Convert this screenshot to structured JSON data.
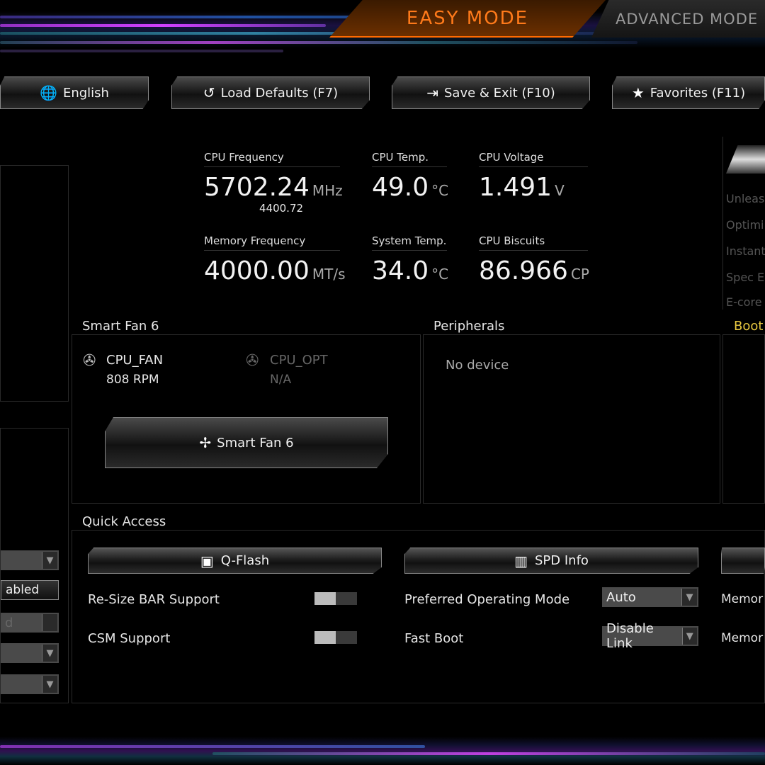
{
  "header": {
    "tabs": [
      {
        "label": "EASY MODE",
        "active": true
      },
      {
        "label": "ADVANCED MODE",
        "active": false
      }
    ],
    "accent": "#ff7a1a"
  },
  "toolbar": {
    "language": "English",
    "load_defaults": "Load Defaults (F7)",
    "save_exit": "Save & Exit (F10)",
    "favorites": "Favorites (F11)"
  },
  "stats": {
    "cpu_freq": {
      "label": "CPU Frequency",
      "value": "5702.24",
      "unit": "MHz",
      "sub": "4400.72"
    },
    "cpu_temp": {
      "label": "CPU Temp.",
      "value": "49.0",
      "unit": "°C"
    },
    "cpu_voltage": {
      "label": "CPU Voltage",
      "value": "1.491",
      "unit": "V"
    },
    "mem_freq": {
      "label": "Memory Frequency",
      "value": "4000.00",
      "unit": "MT/s"
    },
    "sys_temp": {
      "label": "System Temp.",
      "value": "34.0",
      "unit": "°C"
    },
    "cpu_biscuits": {
      "label": "CPU Biscuits",
      "value": "86.966",
      "unit": "CP"
    }
  },
  "right_panel": {
    "items": [
      "Unleas",
      "Optimi",
      "Instant",
      "Spec E",
      "E-core"
    ]
  },
  "smart_fan": {
    "title": "Smart Fan 6",
    "fans": [
      {
        "name": "CPU_FAN",
        "value": "808 RPM"
      },
      {
        "name": "CPU_OPT",
        "value": "N/A"
      }
    ],
    "button": "Smart Fan 6"
  },
  "peripherals": {
    "title": "Peripherals",
    "empty": "No device"
  },
  "boot": {
    "title": "Boot"
  },
  "left_panel": {
    "items": [
      "",
      "abled",
      "d",
      "",
      ""
    ]
  },
  "quick_access": {
    "title": "Quick Access",
    "qflash": "Q-Flash",
    "spd": "SPD Info",
    "settings": [
      {
        "label": "Re-Size BAR Support",
        "type": "toggle",
        "on": false
      },
      {
        "label": "CSM Support",
        "type": "toggle",
        "on": false
      },
      {
        "label": "Preferred Operating Mode",
        "value": "Auto"
      },
      {
        "label": "Fast Boot",
        "value": "Disable Link"
      },
      {
        "label": "Memor"
      },
      {
        "label": "Memor"
      }
    ]
  }
}
